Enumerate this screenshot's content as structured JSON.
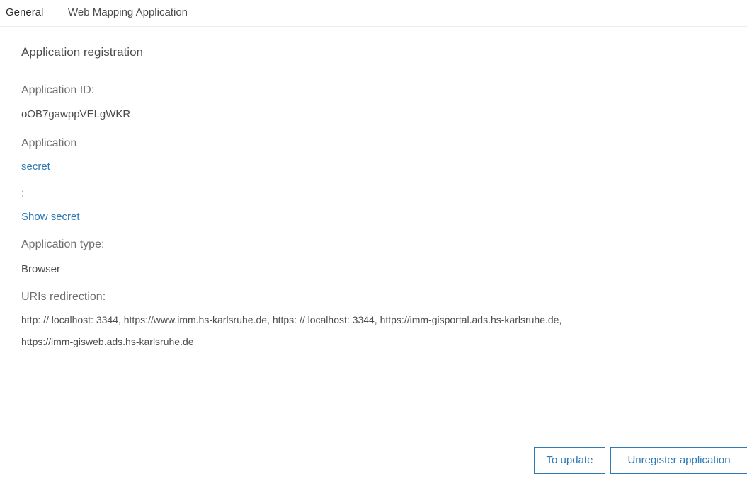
{
  "tabs": [
    {
      "label": "General",
      "active": true
    },
    {
      "label": "Web Mapping Application",
      "active": false
    }
  ],
  "registration": {
    "title": "Application registration",
    "app_id_label": "Application ID:",
    "app_id_value": "oOB7gawppVELgWKR",
    "application_label": "Application",
    "secret_link": "secret",
    "colon": ":",
    "show_secret_link": "Show secret",
    "app_type_label": "Application type:",
    "app_type_value": "Browser",
    "uris_label": "URIs redirection:",
    "uris_line1": "http: // localhost: 3344, https://www.imm.hs-karlsruhe.de, https: // localhost: 3344, https://imm-gisportal.ads.hs-karlsruhe.de,",
    "uris_line2": "https://imm-gisweb.ads.hs-karlsruhe.de"
  },
  "buttons": {
    "update": "To update",
    "unregister": "Unregister application"
  },
  "colors": {
    "link": "#2f7ab5",
    "text": "#4c4c4c",
    "border": "#e6e6e6"
  }
}
